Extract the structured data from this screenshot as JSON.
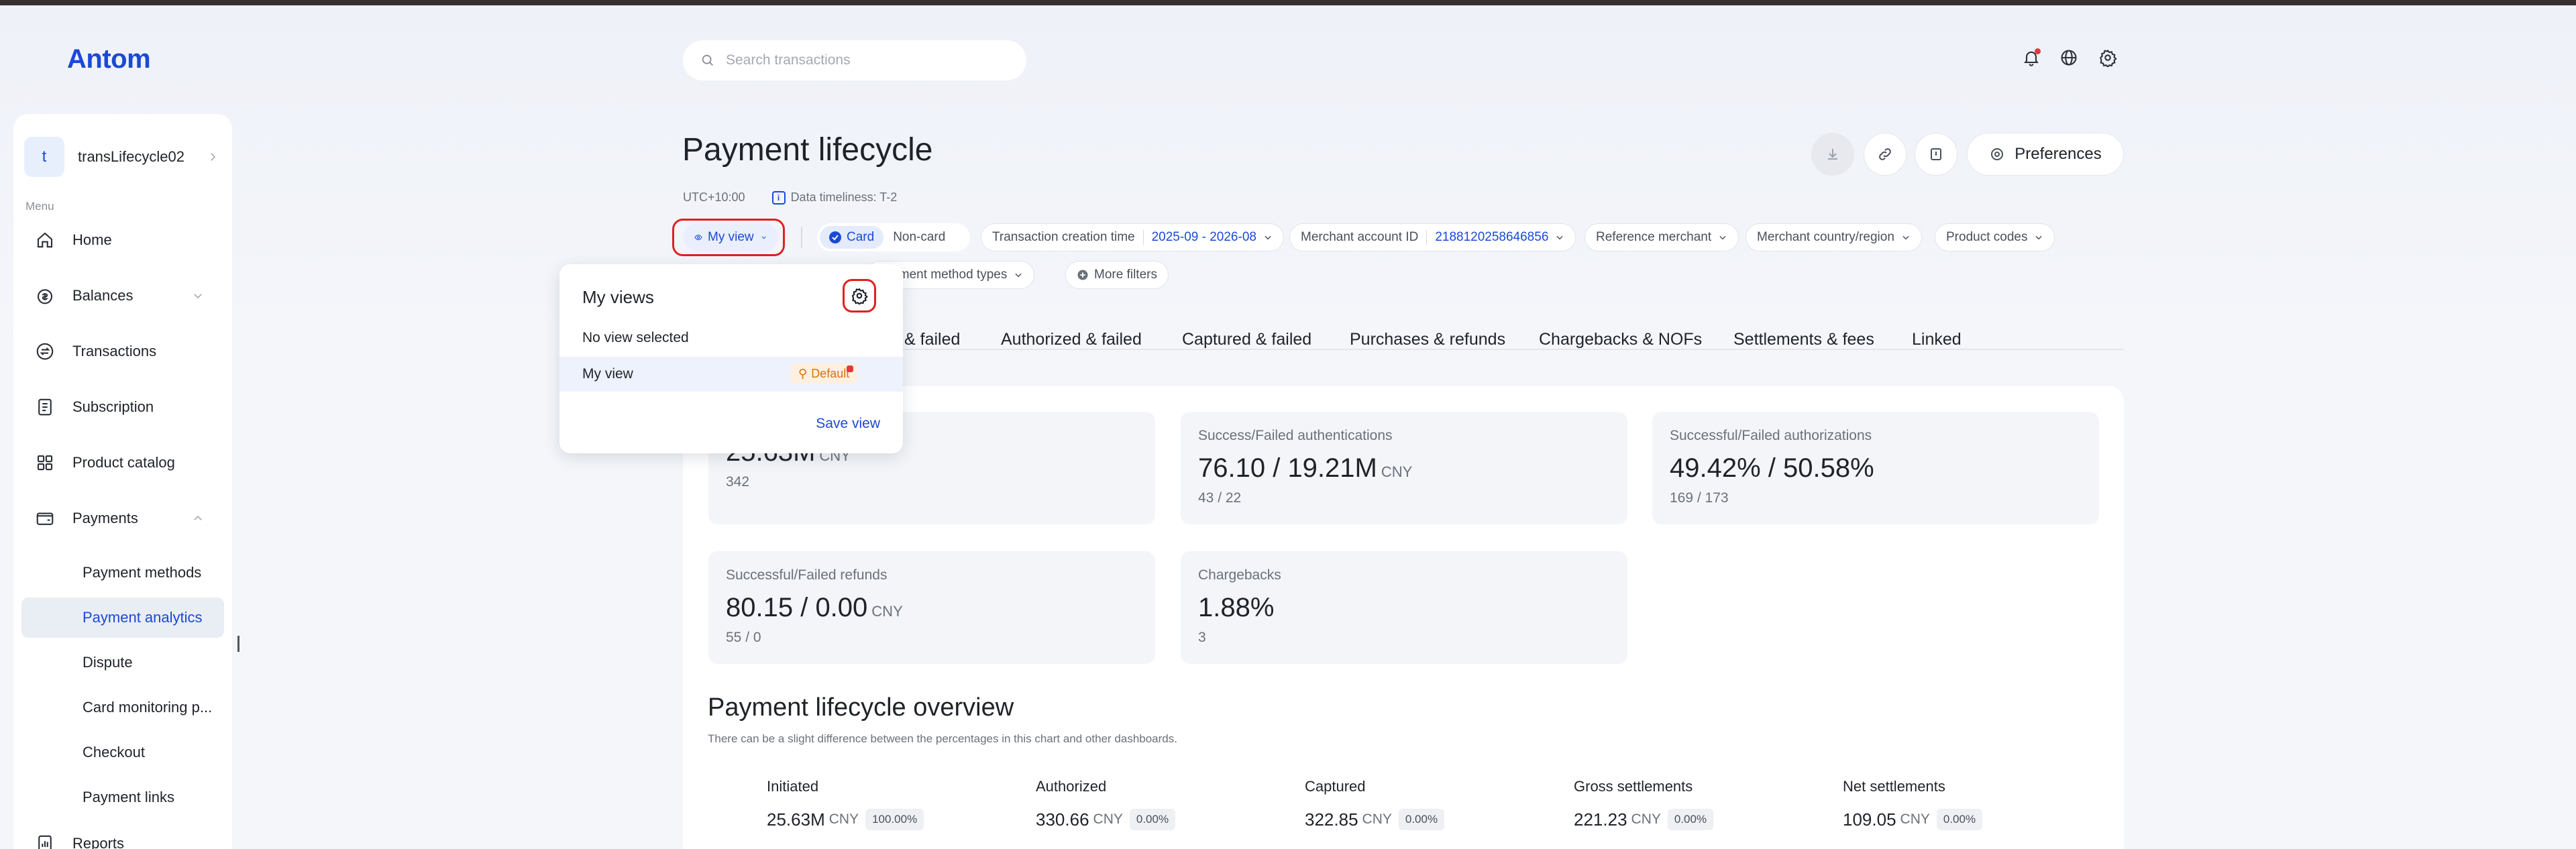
{
  "brand": {
    "logo": "Antom",
    "accent": "#1a49d6"
  },
  "search": {
    "placeholder": "Search transactions"
  },
  "topbar": {
    "icons": [
      "bell-icon",
      "globe-icon",
      "gear-icon"
    ]
  },
  "sidebar": {
    "account": {
      "initial": "t",
      "name": "transLifecycle02"
    },
    "menu_label": "Menu",
    "items": [
      {
        "label": "Home",
        "icon": "home-icon"
      },
      {
        "label": "Balances",
        "icon": "coin-icon"
      },
      {
        "label": "Transactions",
        "icon": "transfer-icon"
      },
      {
        "label": "Subscription",
        "icon": "document-icon"
      },
      {
        "label": "Product catalog",
        "icon": "grid-icon"
      },
      {
        "label": "Payments",
        "icon": "wallet-icon"
      }
    ],
    "subitems": [
      {
        "label": "Payment methods"
      },
      {
        "label": "Payment analytics",
        "active": true
      },
      {
        "label": "Dispute"
      },
      {
        "label": "Card monitoring p..."
      },
      {
        "label": "Checkout"
      },
      {
        "label": "Payment links"
      },
      {
        "label": "Reports"
      }
    ]
  },
  "header": {
    "title": "Payment lifecycle",
    "timezone": "UTC+10:00",
    "timeliness": "Data timeliness: T-2",
    "preferences_label": "Preferences"
  },
  "filters": {
    "my_view": "My view",
    "card": "Card",
    "non_card": "Non-card",
    "transaction_time_label": "Transaction creation time",
    "transaction_time_value": "2025-09 - 2026-08",
    "merchant_id_label": "Merchant account ID",
    "merchant_id_value": "2188120258646856",
    "reference_merchant": "Reference merchant",
    "merchant_country": "Merchant country/region",
    "product_codes": "Product codes",
    "payment_method_types": "Payment method types",
    "more_filters": "More filters"
  },
  "tabs": [
    "& failed",
    "Authorized & failed",
    "Captured & failed",
    "Purchases & refunds",
    "Chargebacks & NOFs",
    "Settlements & fees",
    "Linked"
  ],
  "metrics": [
    {
      "label": "",
      "value": "25.63M",
      "unit": "CNY",
      "sub": "342"
    },
    {
      "label": "Success/Failed authentications",
      "value": "76.10 / 19.21M",
      "unit": "CNY",
      "sub": "43 / 22"
    },
    {
      "label": "Successful/Failed authorizations",
      "value": "49.42% / 50.58%",
      "unit": "",
      "sub": "169 / 173"
    },
    {
      "label": "Successful/Failed refunds",
      "value": "80.15 / 0.00",
      "unit": "CNY",
      "sub": "55 / 0"
    },
    {
      "label": "Chargebacks",
      "value": "1.88%",
      "unit": "",
      "sub": "3"
    }
  ],
  "overview": {
    "title": "Payment lifecycle overview",
    "description": "There can be a slight difference between the percentages in this chart and other dashboards.",
    "stages": [
      {
        "label": "Initiated",
        "value": "25.63M",
        "unit": "CNY",
        "pct": "100.00%"
      },
      {
        "label": "Authorized",
        "value": "330.66",
        "unit": "CNY",
        "pct": "0.00%"
      },
      {
        "label": "Captured",
        "value": "322.85",
        "unit": "CNY",
        "pct": "0.00%"
      },
      {
        "label": "Gross settlements",
        "value": "221.23",
        "unit": "CNY",
        "pct": "0.00%"
      },
      {
        "label": "Net settlements",
        "value": "109.05",
        "unit": "CNY",
        "pct": "0.00%"
      }
    ]
  },
  "dropdown": {
    "title": "My views",
    "no_view": "No view selected",
    "view_name": "My view",
    "default_badge": "Default",
    "save_label": "Save view"
  }
}
